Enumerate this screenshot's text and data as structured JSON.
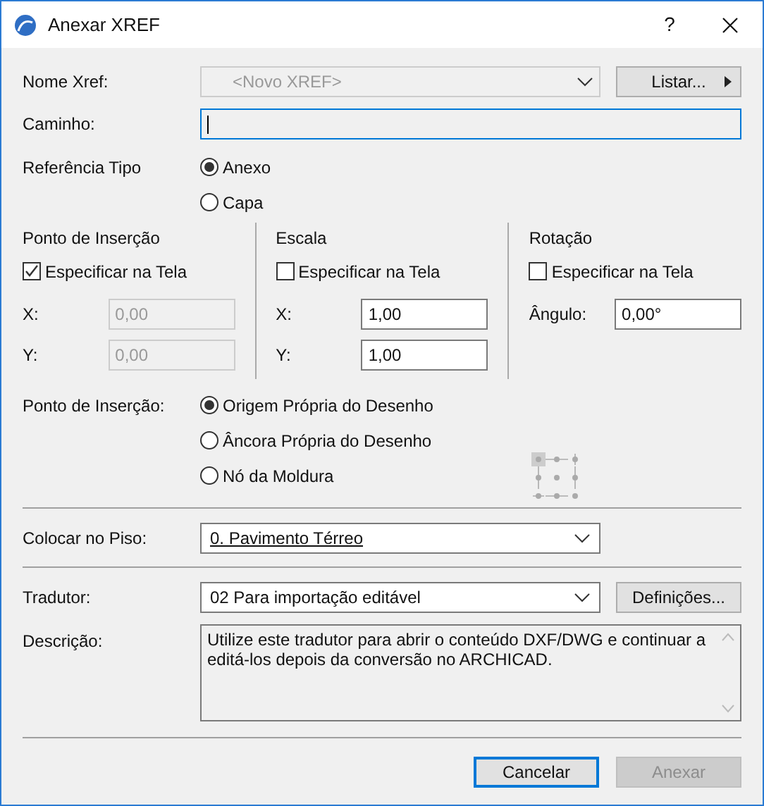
{
  "window": {
    "title": "Anexar XREF",
    "help": "?"
  },
  "xref_name": {
    "label": "Nome Xref:",
    "placeholder": "<Novo XREF>",
    "disabled": true
  },
  "list_button": {
    "label": "Listar..."
  },
  "path": {
    "label": "Caminho:",
    "focused": true
  },
  "reference_type": {
    "label": "Referência Tipo",
    "options": [
      {
        "label": "Anexo",
        "selected": true
      },
      {
        "label": "Capa",
        "selected": false
      }
    ]
  },
  "sections": [
    {
      "title": "Ponto de Inserção",
      "specify": {
        "label": "Especificar na Tela",
        "checked": true
      },
      "fields": [
        {
          "label": "X:",
          "value": "0,00",
          "disabled": true
        },
        {
          "label": "Y:",
          "value": "0,00",
          "disabled": true
        }
      ]
    },
    {
      "title": "Escala",
      "specify": {
        "label": "Especificar na Tela",
        "checked": false
      },
      "fields": [
        {
          "label": "X:",
          "value": "1,00",
          "disabled": false
        },
        {
          "label": "Y:",
          "value": "1,00",
          "disabled": false
        }
      ]
    },
    {
      "title": "Rotação",
      "specify": {
        "label": "Especificar na Tela",
        "checked": false
      },
      "fields": [
        {
          "label": "Ângulo:",
          "value": "0,00°",
          "disabled": false
        }
      ]
    }
  ],
  "insertion_mode": {
    "label": "Ponto de Inserção:",
    "options": [
      {
        "label": "Origem Própria do Desenho",
        "selected": true
      },
      {
        "label": "Âncora Própria do Desenho",
        "selected": false
      },
      {
        "label": "Nó da Moldura",
        "selected": false
      }
    ]
  },
  "story": {
    "label": "Colocar no Piso:",
    "value": "0. Pavimento Térreo"
  },
  "translator": {
    "label": "Tradutor:",
    "value": "02 Para importação editável"
  },
  "settings_button": {
    "label": "Definições..."
  },
  "description": {
    "label": "Descrição:",
    "text": "Utilize este tradutor para abrir o conteúdo DXF/DWG e continuar a editá-los depois da conversão no ARCHICAD."
  },
  "buttons": [
    {
      "label": "Cancelar",
      "default": true,
      "disabled": false
    },
    {
      "label": "Anexar",
      "default": false,
      "disabled": true
    }
  ]
}
